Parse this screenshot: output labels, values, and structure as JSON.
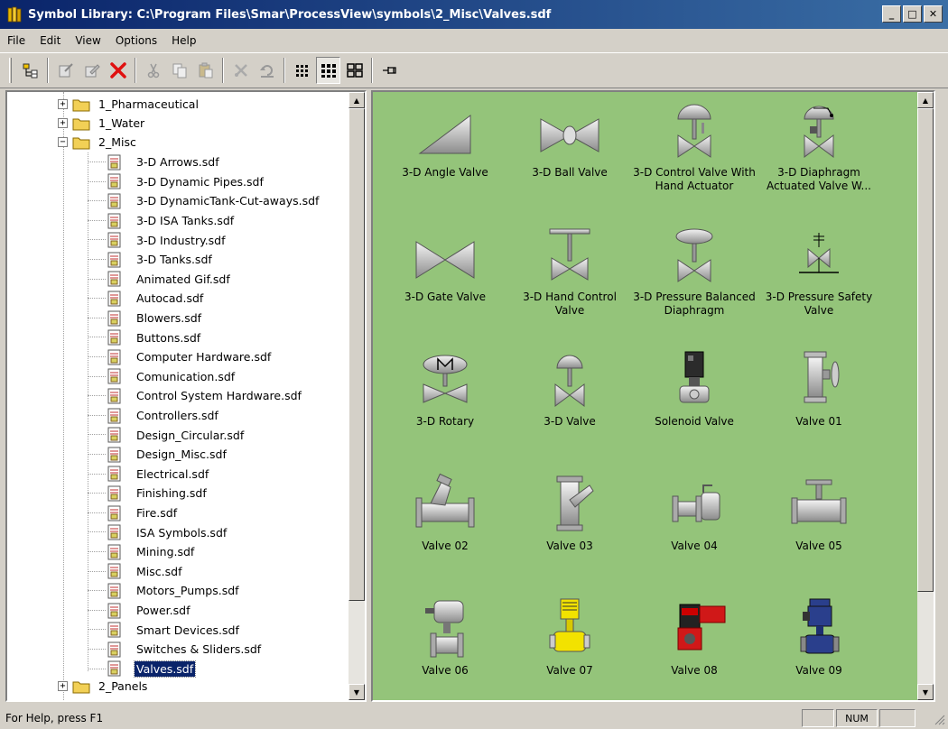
{
  "window": {
    "title": "Symbol Library: C:\\Program Files\\Smar\\ProcessView\\symbols\\2_Misc\\Valves.sdf",
    "minimize": "_",
    "maximize": "□",
    "close": "✕"
  },
  "menu": [
    "File",
    "Edit",
    "View",
    "Options",
    "Help"
  ],
  "toolbar": {
    "buttons": [
      "tree-toggle-icon",
      "new-icon",
      "edit-icon",
      "delete-icon",
      "cut-icon",
      "copy-icon",
      "paste-icon",
      "cut-symbol-icon",
      "undo-icon",
      "small-icons-view-icon",
      "large-icons-view-icon",
      "tiles-view-icon",
      "pin-icon"
    ]
  },
  "tree": {
    "folders": [
      {
        "label": "1_Pharmaceutical",
        "expander": "+"
      },
      {
        "label": "1_Water",
        "expander": "+"
      },
      {
        "label": "2_Misc",
        "expander": "−"
      }
    ],
    "files": [
      "3-D Arrows.sdf",
      "3-D Dynamic Pipes.sdf",
      "3-D DynamicTank-Cut-aways.sdf",
      "3-D ISA Tanks.sdf",
      "3-D Industry.sdf",
      "3-D Tanks.sdf",
      "Animated Gif.sdf",
      "Autocad.sdf",
      "Blowers.sdf",
      "Buttons.sdf",
      "Computer Hardware.sdf",
      "Comunication.sdf",
      "Control System Hardware.sdf",
      "Controllers.sdf",
      "Design_Circular.sdf",
      "Design_Misc.sdf",
      "Electrical.sdf",
      "Finishing.sdf",
      "Fire.sdf",
      "ISA Symbols.sdf",
      "Mining.sdf",
      "Misc.sdf",
      "Motors_Pumps.sdf",
      "Power.sdf",
      "Smart Devices.sdf",
      "Switches & Sliders.sdf",
      "Valves.sdf"
    ],
    "selected_file": "Valves.sdf",
    "after_folder": {
      "label": "2_Panels",
      "expander": "+"
    }
  },
  "symbols": {
    "row1": [
      "3-D Angle Valve",
      "3-D Ball Valve",
      "3-D Control Valve With Hand Actuator",
      "3-D Diaphragm Actuated Valve W..."
    ],
    "row2": [
      "3-D Gate Valve",
      "3-D Hand Control Valve",
      "3-D Pressure Balanced Diaphragm",
      "3-D Pressure Safety Valve"
    ],
    "row3": [
      "3-D Rotary",
      "3-D Valve",
      "Solenoid Valve",
      "Valve 01"
    ],
    "row4": [
      "Valve 02",
      "Valve 03",
      "Valve 04",
      "Valve 05"
    ],
    "row5": [
      "Valve 06",
      "Valve 07",
      "Valve 08",
      "Valve 09"
    ]
  },
  "statusbar": {
    "text": "For Help, press F1",
    "num": "NUM"
  }
}
